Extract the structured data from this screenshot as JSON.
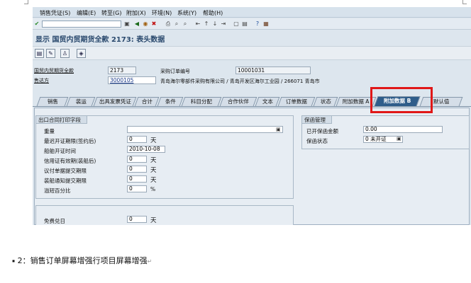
{
  "menu": [
    "销售凭证(S)",
    "编辑(E)",
    "转至(G)",
    "附加(X)",
    "环境(N)",
    "系统(Y)",
    "帮助(H)"
  ],
  "window_title": "显示 国贸内贸期货全款 2173: 表头数据",
  "header": {
    "order_label": "国贸内贸期货全款",
    "order_value": "2173",
    "party_label": "售达方",
    "party_value": "3000105",
    "po_label": "采购订单编号",
    "po_value": "10001031",
    "party_desc": "青岛海尔零部件采购有限公司 / 青岛开发区海尔工业园 / 266071 青岛市"
  },
  "tabs": [
    "销售",
    "装运",
    "出具发票凭证",
    "合计",
    "条件",
    "科目分配",
    "合作伙伴",
    "文本",
    "订单数据",
    "状态",
    "附加数据 A",
    "附加数据 B",
    "默认值"
  ],
  "left_group": {
    "title": "出口合同打印字段",
    "rows": [
      {
        "label": "重量",
        "value": ""
      },
      {
        "label": "最迟开证期限(签约后)",
        "value": "0",
        "unit": "天"
      },
      {
        "label": "船舶开证时间",
        "value": "2010-10-08"
      },
      {
        "label": "信用证有效期(装船后)",
        "value": "0",
        "unit": "天"
      },
      {
        "label": "议付单据提交期限",
        "value": "0",
        "unit": "天"
      },
      {
        "label": "装船通知提交期限",
        "value": "0",
        "unit": "天"
      },
      {
        "label": "溢短百分比",
        "value": "0",
        "unit": "%"
      }
    ]
  },
  "left_group2": {
    "label": "免费兑日",
    "value": "0",
    "unit": "天"
  },
  "right_group": {
    "title": "保函管理",
    "rows": [
      {
        "label": "已开保函金额",
        "value": "0.00"
      },
      {
        "label": "保函状态",
        "value": "0 未开证"
      }
    ]
  },
  "caption": "2：销售订单屏幕增强行项目屏幕增强",
  "colors": {
    "highlight": "#e01717",
    "active_tab": "#2f5d8a"
  }
}
